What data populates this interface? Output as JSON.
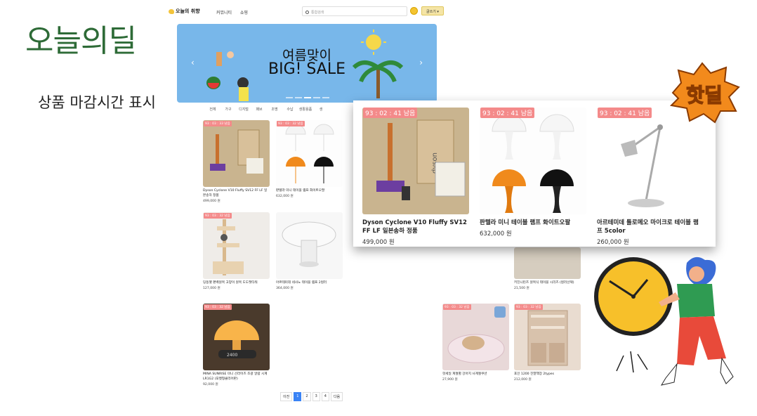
{
  "slide": {
    "title": "오늘의딜",
    "subtitle": "상품 마감시간 표시",
    "badge": "핫딜"
  },
  "shop": {
    "logo": "오늘의 취향",
    "nav": [
      "커뮤니티",
      "쇼핑"
    ],
    "search_placeholder": "통합검색",
    "login_label": "글쓰기",
    "banner": {
      "line1": "여름맞이",
      "line2": "BIG! SALE",
      "bg": "#78b7ea"
    },
    "categories": [
      "전체",
      "가구",
      "디지털",
      "패브",
      "조명",
      "수납",
      "생활용품",
      "생"
    ],
    "products": [
      {
        "timer": "93 : 03 : 33 남음",
        "name": "Dyson Cyclone V10 Fluffy SV12 FF LF 일본송하 정품",
        "price": "499,000 원",
        "img_color": "#c9b48f"
      },
      {
        "timer": "93 : 03 : 32 남음",
        "name": "판텔라 미니 테이블 램프 화이트오팔",
        "price": "632,000 원",
        "img_color": "#fdfdfd"
      },
      {
        "timer": "93 : 03 : 32 남음",
        "name": "딩동펫 편백원목 고양이 원목 도도캣타워",
        "price": "127,000 원",
        "img_color": "#efece8"
      },
      {
        "timer": "",
        "name": "아르테미데 네사노 테이블 램프 2컬러",
        "price": "364,000 원",
        "img_color": "#f7f7f7"
      },
      {
        "timer": "",
        "name": "키친니린즈 원목식 테이블 시리즈 (컬러선택)",
        "price": "21,500 원",
        "img_color": "#d6cdbf"
      },
      {
        "timer": "93 : 03 : 32 남음",
        "name": "MINA SUNRISE 미니 선라이즈 조광 알람 시계 LR1G2 (포켓형클리어판)",
        "price": "92,000 원",
        "img_color": "#4a3a2c"
      },
      {
        "timer": "93 : 03 : 32 남음",
        "name": "핫세일 계절별 강아지 사계절쿠션",
        "price": "27,900 원",
        "img_color": "#e8d8d8"
      },
      {
        "timer": "93 : 03 : 32 남음",
        "name": "포인 1200 진열책장 2types",
        "price": "212,000 원",
        "img_color": "#e9dcd0"
      }
    ],
    "pagination": [
      "이전",
      "1",
      "2",
      "3",
      "4",
      "다음"
    ]
  },
  "zoom": {
    "products": [
      {
        "timer": "93 : 02 : 41 남음",
        "name": "Dyson Cyclone V10 Fluffy SV12 FF LF 일본송하 정품",
        "price": "499,000 원"
      },
      {
        "timer": "93 : 02 : 41 남음",
        "name": "판텔라 미니 테이블 램프 화이트오팔",
        "price": "632,000 원"
      },
      {
        "timer": "93 : 02 : 41 남음",
        "name": "아르테미데 톨로메오 마이크로 테이블 램프 5color",
        "price": "260,000 원"
      }
    ]
  },
  "colors": {
    "accent_green": "#2e6b37",
    "timer_tag": "#f48a8a",
    "pager_active": "#3a83f5"
  }
}
